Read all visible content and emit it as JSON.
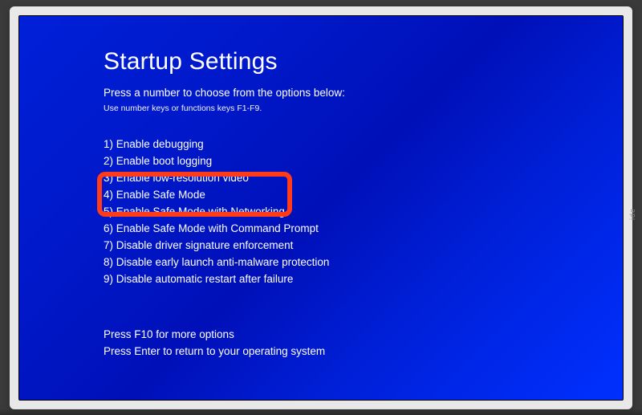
{
  "title": "Startup Settings",
  "subtitle": "Press a number to choose from the options below:",
  "hint": "Use number keys or functions keys F1-F9.",
  "options": [
    "1) Enable debugging",
    "2) Enable boot logging",
    "3) Enable low-resolution video",
    "4) Enable Safe Mode",
    "5) Enable Safe Mode with Networking",
    "6) Enable Safe Mode with Command Prompt",
    "7) Disable driver signature enforcement",
    "8) Disable early launch anti-malware protection",
    "9) Disable automatic restart after failure"
  ],
  "footer": {
    "more_options": "Press F10 for more options",
    "return": "Press Enter to return to your operating system"
  },
  "highlight": {
    "color": "#ff3b1a",
    "covers_options": [
      3,
      4
    ]
  },
  "bezel_label": "ide"
}
